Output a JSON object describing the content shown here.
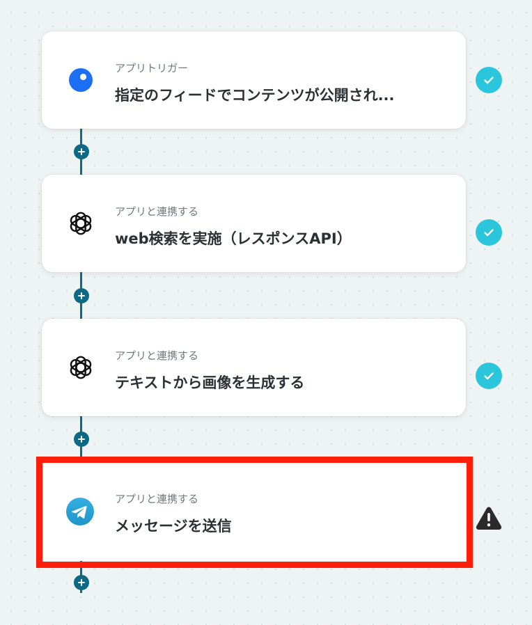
{
  "flow": {
    "steps": [
      {
        "kind": "アプリトリガー",
        "title": "指定のフィードでコンテンツが公開され...",
        "icon": "rss-feed-icon",
        "status": "completed"
      },
      {
        "kind": "アプリと連携する",
        "title": "web検索を実施（レスポンスAPI）",
        "icon": "openai-icon",
        "status": "completed"
      },
      {
        "kind": "アプリと連携する",
        "title": "テキストから画像を生成する",
        "icon": "openai-icon",
        "status": "completed"
      },
      {
        "kind": "アプリと連携する",
        "title": "メッセージを送信",
        "icon": "telegram-icon",
        "status": "warning",
        "selected": true
      }
    ],
    "add_step_symbol": "+"
  },
  "colors": {
    "connector": "#0e6a84",
    "completed": "#2bc6dc",
    "warning": "#2b2b2b",
    "highlight": "#ff1e0a",
    "rss_blue": "#1c6ef2",
    "telegram_blue": "#2aa3e0"
  }
}
